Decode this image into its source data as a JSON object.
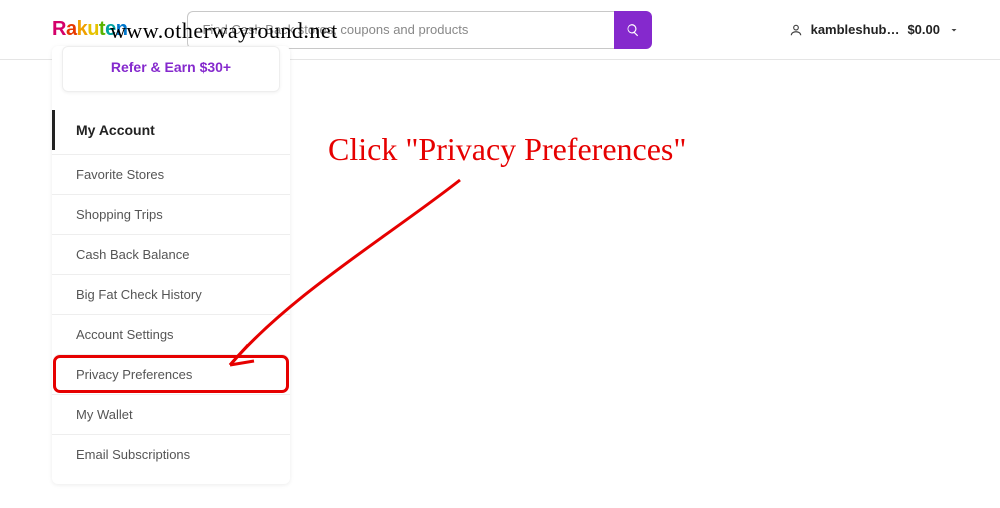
{
  "watermark_text": "www.otherwayround.net",
  "header": {
    "logo_text": "Rakuten",
    "search_placeholder": "Find Cash Back stores, coupons and products",
    "username": "kambleshub…",
    "balance": "$0.00"
  },
  "sidebar": {
    "refer_label": "Refer & Earn $30+",
    "section_title": "My Account",
    "items": [
      "Favorite Stores",
      "Shopping Trips",
      "Cash Back Balance",
      "Big Fat Check History",
      "Account Settings",
      "Privacy Preferences",
      "My Wallet",
      "Email Subscriptions"
    ],
    "highlight_index": 5
  },
  "annotation": {
    "text": "Click \"Privacy Preferences\""
  }
}
